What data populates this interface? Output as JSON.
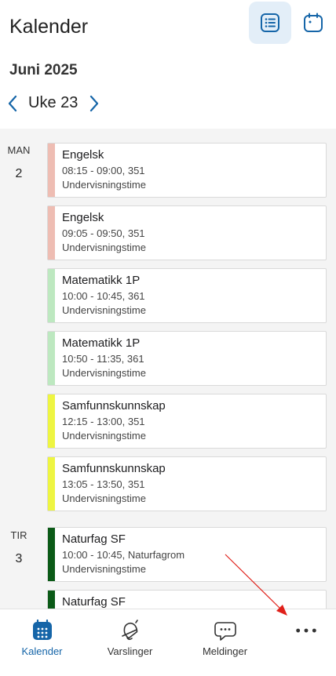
{
  "header": {
    "title": "Kalender",
    "list_view_icon": "list-view-icon",
    "calendar_view_icon": "calendar-view-icon"
  },
  "period": {
    "month": "Juni 2025",
    "week": "Uke 23"
  },
  "days": [
    {
      "label": "MAN",
      "number": "2",
      "lessons": [
        {
          "subject": "Engelsk",
          "time": "08:15 - 09:00, 351",
          "type": "Undervisningstime",
          "color": "#eebdb3"
        },
        {
          "subject": "Engelsk",
          "time": "09:05 - 09:50, 351",
          "type": "Undervisningstime",
          "color": "#eebdb3"
        },
        {
          "subject": "Matematikk 1P",
          "time": "10:00 - 10:45, 361",
          "type": "Undervisningstime",
          "color": "#bde8c0"
        },
        {
          "subject": "Matematikk 1P",
          "time": "10:50 - 11:35, 361",
          "type": "Undervisningstime",
          "color": "#bde8c0"
        },
        {
          "subject": "Samfunnskunnskap",
          "time": "12:15 - 13:00, 351",
          "type": "Undervisningstime",
          "color": "#eef542"
        },
        {
          "subject": "Samfunnskunnskap",
          "time": "13:05 - 13:50, 351",
          "type": "Undervisningstime",
          "color": "#eef542"
        }
      ]
    },
    {
      "label": "TIR",
      "number": "3",
      "lessons": [
        {
          "subject": "Naturfag SF",
          "time": "10:00 - 10:45, Naturfagrom",
          "type": "Undervisningstime",
          "color": "#0b5a17"
        },
        {
          "subject": "Naturfag SF",
          "time": "",
          "type": "",
          "color": "#0b5a17"
        }
      ]
    }
  ],
  "tabs": [
    {
      "label": "Kalender",
      "icon": "calendar-grid-icon",
      "active": true
    },
    {
      "label": "Varslinger",
      "icon": "bell-icon",
      "active": false
    },
    {
      "label": "Meldinger",
      "icon": "chat-bubble-icon",
      "active": false
    },
    {
      "label": "",
      "icon": "more-dots-icon",
      "active": false
    }
  ],
  "colors": {
    "accent": "#1565a8",
    "active_view_bg": "#e3eef8",
    "schedule_bg": "#f4f4f4",
    "annotation_arrow": "#e0201a"
  }
}
